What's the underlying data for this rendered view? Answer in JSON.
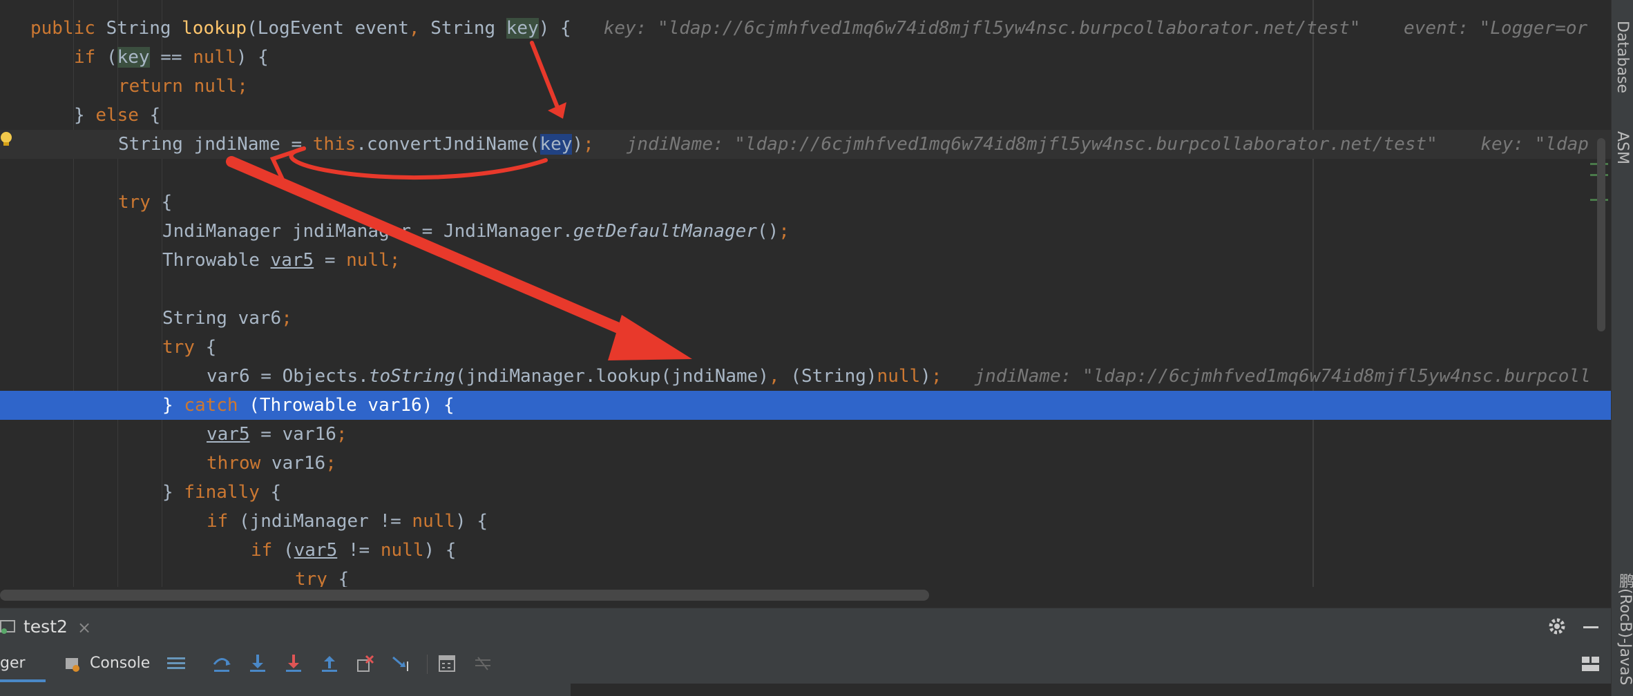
{
  "code": {
    "line1": {
      "t1": "public ",
      "t2": "String ",
      "fn": "lookup",
      "t3": "(LogEvent event",
      "t4": ", ",
      "t5": "String ",
      "param": "key",
      "t6": ") {",
      "hint1": "key: \"ldap://6cjmhfved1mq6w74id8mjfl5yw4nsc.burpcollaborator.net/test\"",
      "hint2": "event: \"Logger=or"
    },
    "line2": {
      "kw": "if",
      "t1": " (",
      "param": "key",
      "t2": " == ",
      "kw2": "null",
      "t3": ") {"
    },
    "line3": {
      "kw": "return ",
      "kw2": "null",
      "t1": ";"
    },
    "line4": {
      "t1": "} ",
      "kw": "else",
      "t2": " {"
    },
    "line5": {
      "t1": "String jndiName = ",
      "kw": "this",
      "t2": ".convertJndiName(",
      "sel": "key",
      "t3": ")",
      "t4": ";",
      "hint1": "jndiName: \"ldap://6cjmhfved1mq6w74id8mjfl5yw4nsc.burpcollaborator.net/test\"",
      "hint2": "key: \"ldap"
    },
    "line7": {
      "kw": "try",
      "t1": " {"
    },
    "line8": {
      "t1": "JndiManager jndiManager = JndiManager.",
      "it": "getDefaultManager",
      "t2": "()",
      "t3": ";"
    },
    "line9": {
      "t1": "Throwable ",
      "und": "var5",
      "t2": " = ",
      "kw": "null",
      "t3": ";"
    },
    "line11": {
      "t1": "String var6",
      "t2": ";"
    },
    "line12": {
      "kw": "try",
      "t1": " {"
    },
    "line13": {
      "t1": "var6 = Objects.",
      "it": "toString",
      "t2": "(jndiManager.lookup(jndiName)",
      "t3": ", ",
      "t4": "(String)",
      "kw": "null",
      "t5": ")",
      "t6": ";",
      "hint1": "jndiName: \"ldap://6cjmhfved1mq6w74id8mjfl5yw4nsc.burpcoll"
    },
    "line14": {
      "t1": "} ",
      "kw": "catch",
      "t2": " (Throwable var16) {"
    },
    "line15": {
      "und": "var5",
      "t1": " = var16",
      "t2": ";"
    },
    "line16": {
      "kw": "throw ",
      "t1": "var16",
      "t2": ";"
    },
    "line17": {
      "t1": "} ",
      "kw": "finally",
      "t2": " {"
    },
    "line18": {
      "kw": "if",
      "t1": " (jndiManager != ",
      "kw2": "null",
      "t2": ") {"
    },
    "line19": {
      "kw": "if",
      "t1": " (",
      "und": "var5",
      "t2": " != ",
      "kw2": "null",
      "t3": ") {"
    },
    "line20": {
      "kw": "try",
      "t1": " {"
    }
  },
  "right_tabs": {
    "database": "Database",
    "asm": "ASM",
    "plugin": "鹏(RocB)-JavaS"
  },
  "debug": {
    "tab_name": "test2",
    "debugger_label": "ger",
    "console_label": "Console"
  },
  "colors": {
    "keyword": "#cc7832",
    "function": "#ffc66d",
    "text": "#a9b7c6",
    "selection": "#2f65ca",
    "annotation": "#e8392b"
  }
}
